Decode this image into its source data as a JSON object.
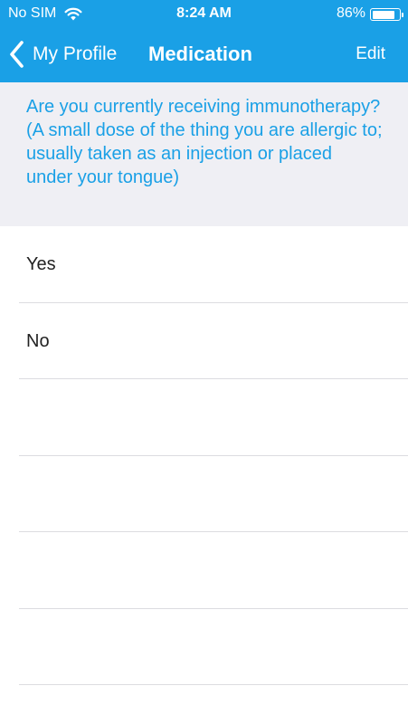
{
  "status_bar": {
    "carrier": "No SIM",
    "time": "8:24 AM",
    "battery_percent_label": "86%",
    "battery_level": 0.86,
    "wifi_icon": "wifi-icon",
    "battery_icon": "battery-icon"
  },
  "nav": {
    "back_label": "My Profile",
    "title": "Medication",
    "edit_label": "Edit",
    "back_icon": "chevron-left-icon"
  },
  "question": {
    "text": "Are you currently receiving immunotherapy? (A small dose of the thing you are allergic to; usually taken as an injection or placed under your tongue)"
  },
  "options": [
    {
      "label": "Yes"
    },
    {
      "label": "No"
    },
    {
      "label": ""
    },
    {
      "label": ""
    },
    {
      "label": ""
    },
    {
      "label": ""
    }
  ],
  "colors": {
    "accent": "#1aa0e6",
    "header_background": "#efeff4",
    "separator": "#dcdce0"
  }
}
